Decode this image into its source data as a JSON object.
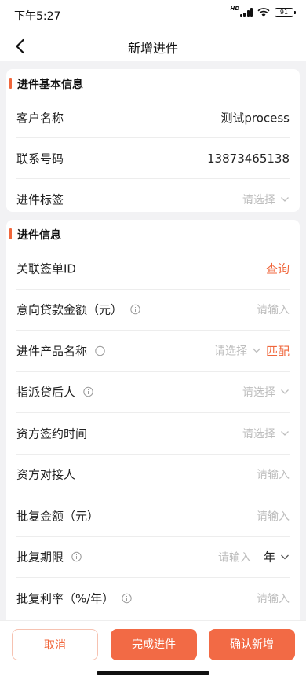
{
  "status_bar": {
    "time": "下午5:27",
    "network": "HD",
    "battery": "91"
  },
  "nav": {
    "title": "新增进件"
  },
  "basic_section": {
    "title": "进件基本信息",
    "rows": [
      {
        "label": "客户名称",
        "value": "测试process"
      },
      {
        "label": "联系号码",
        "value": "13873465138"
      },
      {
        "label": "进件标签",
        "placeholder": "请选择"
      }
    ]
  },
  "info_section": {
    "title": "进件信息",
    "rows": [
      {
        "label": "关联签单ID",
        "action": "查询"
      },
      {
        "label": "意向贷款金额（元）",
        "placeholder": "请输入"
      },
      {
        "label": "进件产品名称",
        "placeholder": "请选择",
        "action": "匹配"
      },
      {
        "label": "指派贷后人",
        "placeholder": "请选择"
      },
      {
        "label": "资方签约时间",
        "placeholder": "请选择"
      },
      {
        "label": "资方对接人",
        "placeholder": "请输入"
      },
      {
        "label": "批复金额（元）",
        "placeholder": "请输入"
      },
      {
        "label": "批复期限",
        "placeholder": "请输入",
        "unit": "年"
      },
      {
        "label": "批复利率（%/年）",
        "placeholder": "请输入"
      }
    ]
  },
  "buttons": {
    "cancel": "取消",
    "complete": "完成进件",
    "confirm": "确认新增"
  },
  "colors": {
    "accent": "#f0663b",
    "button": "#f26a45"
  },
  "icons": {
    "back": "chevron-left-icon",
    "info": "info-circle-icon",
    "dropdown": "chevron-down-icon"
  }
}
